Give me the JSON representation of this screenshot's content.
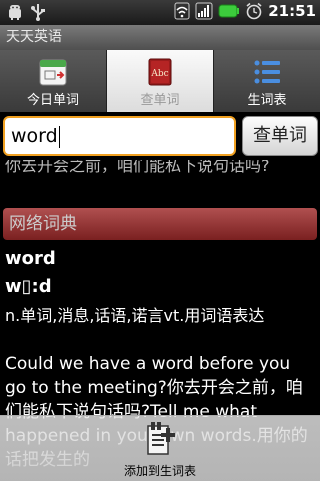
{
  "status": {
    "time": "21:51"
  },
  "app": {
    "title": "天天英语"
  },
  "tabs": [
    {
      "label": "今日单词",
      "icon": "calendar-icon",
      "active": false
    },
    {
      "label": "查单词",
      "icon": "dictionary-book-icon",
      "active": true
    },
    {
      "label": "生词表",
      "icon": "list-icon",
      "active": false
    }
  ],
  "search": {
    "value": "word",
    "button_label": "查单词"
  },
  "result": {
    "previous_line": "你去开会之前，咱们能私下说句话吗?",
    "section_title": "网络词典",
    "word": "word",
    "phonetic": "w▯:d",
    "definition": "n.单词,消息,话语,诺言vt.用词语表达",
    "example": "Could we have a word before you go to the meeting?你去开会之前，咱们能私下说句话吗?Tell me what happened in your own words.用你的话把发生的"
  },
  "bottom_action": {
    "label": "添加到生词表",
    "icon": "add-note-icon"
  }
}
